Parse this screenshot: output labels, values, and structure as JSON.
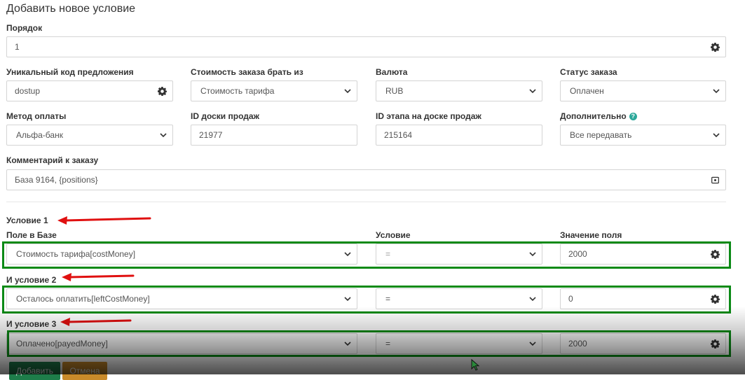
{
  "title": "Добавить новое условие",
  "order": {
    "label": "Порядок",
    "value": "1",
    "icon": "gear-icon"
  },
  "row1": {
    "offer_code": {
      "label": "Уникальный код предложения",
      "value": "dostup",
      "icon": "gear-icon"
    },
    "cost_source": {
      "label": "Стоимость заказа брать из",
      "value": "Стоимость тарифа"
    },
    "currency": {
      "label": "Валюта",
      "value": "RUB"
    },
    "order_status": {
      "label": "Статус заказа",
      "value": "Оплачен"
    }
  },
  "row2": {
    "payment_method": {
      "label": "Метод оплаты",
      "value": "Альфа-банк"
    },
    "board_id": {
      "label": "ID доски продаж",
      "value": "21977"
    },
    "stage_id": {
      "label": "ID этапа на доске продаж",
      "value": "215164"
    },
    "extra": {
      "label": "Дополнительно",
      "value": "Все передавать",
      "help_icon": "?"
    }
  },
  "comment": {
    "label": "Комментарий к заказу",
    "value": "База 9164, {positions}",
    "icon": "code-icon"
  },
  "conditions": {
    "heading1": "Условие 1",
    "col_field": "Поле в Базе",
    "col_condition": "Условие",
    "col_value": "Значение поля",
    "heading2": "И условие 2",
    "heading3": "И условие 3",
    "items": [
      {
        "field": "Стоимость тарифа[costMoney]",
        "operator": "=",
        "value": "2000"
      },
      {
        "field": "Осталось оплатить[leftCostMoney]",
        "operator": "=",
        "value": "0"
      },
      {
        "field": "Оплачено[payedMoney]",
        "operator": "=",
        "value": "2000"
      }
    ]
  },
  "buttons": {
    "add": "Добавить",
    "cancel": "Отмена"
  },
  "colors": {
    "highlight": "#0b8a16",
    "arrow": "#e01010",
    "add_button": "#1e7d4a",
    "cancel_button": "#c98a2a"
  }
}
